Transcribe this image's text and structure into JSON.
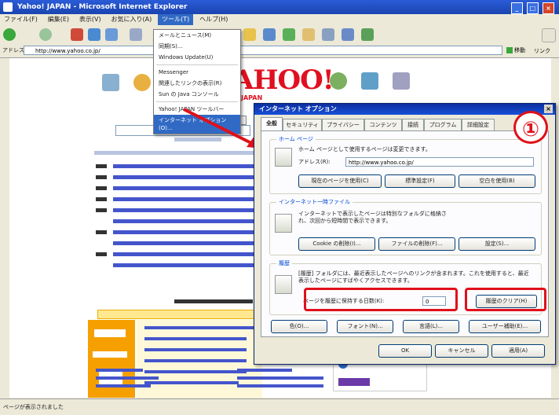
{
  "window": {
    "title": "Yahoo! JAPAN - Microsoft Internet Explorer",
    "buttons": [
      "_",
      "□",
      "×"
    ]
  },
  "menubar": [
    "ファイル(F)",
    "編集(E)",
    "表示(V)",
    "お気に入り(A)",
    "ツール(T)",
    "ヘルプ(H)"
  ],
  "address": {
    "label": "アドレス(D)",
    "url": "http://www.yahoo.co.jp/",
    "go": "移動",
    "links": "リンク"
  },
  "tools_menu": {
    "items": [
      "メールとニュース(M)",
      "同期(S)...",
      "Windows Update(U)",
      "Messenger",
      "関連したリンクの表示(R)",
      "Sun の Java コンソール",
      "Yahoo! JAPAN ツールバー",
      "インターネット オプション(O)..."
    ],
    "selected": "インターネット オプション(O)..."
  },
  "yahoo": {
    "logo": "AHOO!",
    "japan": "JAPAN"
  },
  "dialog": {
    "title": "インターネット オプション",
    "close": "×",
    "tabs": [
      "全般",
      "セキュリティ",
      "プライバシー",
      "コンテンツ",
      "接続",
      "プログラム",
      "詳細設定"
    ],
    "home": {
      "title": "ホーム ページ",
      "desc": "ホーム ページとして使用するページは変更できます。",
      "address_label": "アドレス(R):",
      "address_value": "http://www.yahoo.co.jp/",
      "btn_current": "現在のページを使用(C)",
      "btn_default": "標準設定(F)",
      "btn_blank": "空白を使用(B)"
    },
    "temp": {
      "title": "インターネット一時ファイル",
      "desc": "インターネットで表示したページは特別なフォルダに格納され、次回から短時間で表示できます。",
      "btn_cookie": "Cookie の削除(I)...",
      "btn_files": "ファイルの削除(F)...",
      "btn_settings": "設定(S)..."
    },
    "history": {
      "title": "履歴",
      "desc": "[履歴] フォルダには、最近表示したページへのリンクが含まれます。これを使用すると、最近表示したページにすばやくアクセスできます。",
      "days_label": "ページを履歴に保持する日数(K):",
      "days_value": "0",
      "btn_clear": "履歴のクリア(H)"
    },
    "bottom_buttons": [
      "色(O)...",
      "フォント(N)...",
      "言語(L)...",
      "ユーザー補助(E)..."
    ],
    "footer_buttons": [
      "OK",
      "キャンセル",
      "適用(A)"
    ]
  },
  "annotation": {
    "number": "①"
  },
  "status": {
    "text": "ページが表示されました"
  },
  "colors": {
    "highlight": "#e0101a",
    "title_blue": "#1a44b0",
    "link_blue": "#1a33cc"
  }
}
